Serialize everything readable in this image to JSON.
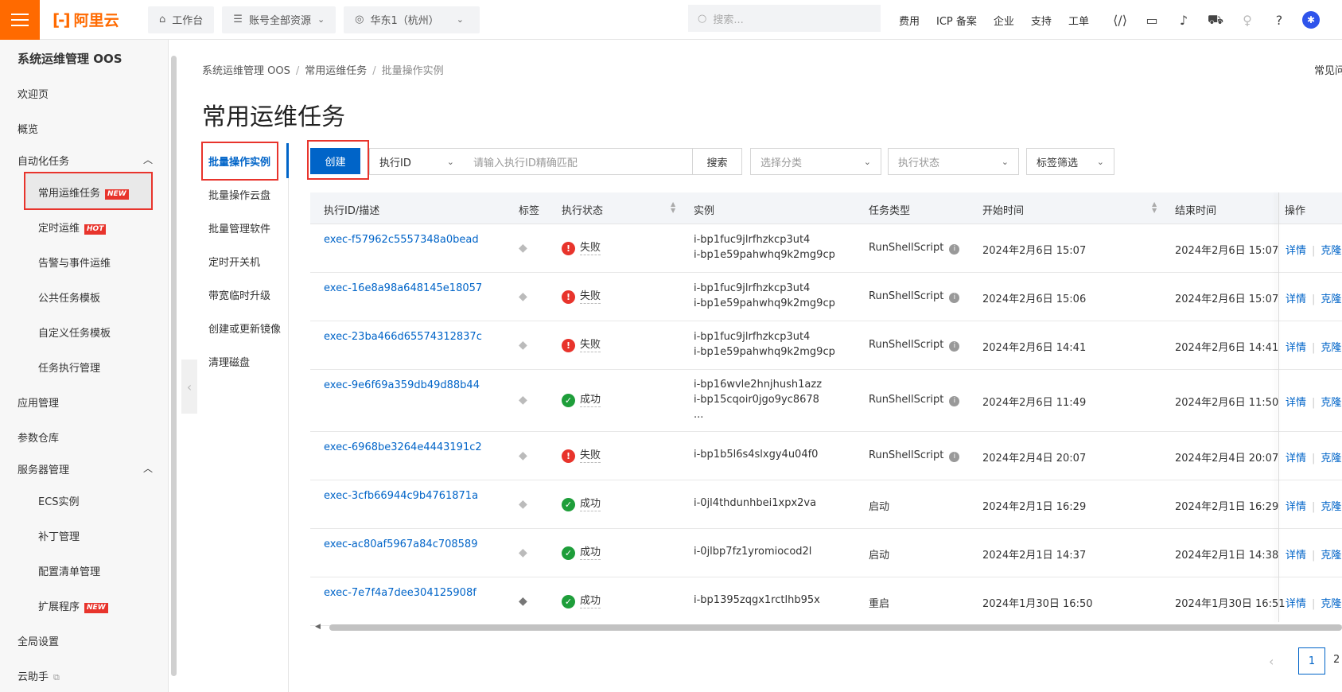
{
  "topbar": {
    "logo_text": "阿里云",
    "workbench": "工作台",
    "resources": "账号全部资源",
    "region": "华东1（杭州）",
    "search_placeholder": "搜索...",
    "links": [
      "费用",
      "ICP 备案",
      "企业",
      "支持",
      "工单"
    ],
    "icons": [
      "code-icon",
      "terminal-icon",
      "bell-icon",
      "cart-icon",
      "bulb-icon",
      "help-icon",
      "avatar-icon"
    ]
  },
  "sidebar": {
    "title": "系统运维管理 OOS",
    "welcome": "欢迎页",
    "overview": "概览",
    "automation_group": "自动化任务",
    "common_tasks": "常用运维任务",
    "scheduled": "定时运维",
    "alarm": "告警与事件运维",
    "public_templates": "公共任务模板",
    "custom_templates": "自定义任务模板",
    "execution_mgmt": "任务执行管理",
    "app_mgmt": "应用管理",
    "param_store": "参数仓库",
    "server_group": "服务器管理",
    "ecs": "ECS实例",
    "patch": "补丁管理",
    "inventory": "配置清单管理",
    "extensions": "扩展程序",
    "global_settings": "全局设置",
    "assistant": "云助手",
    "badge_new": "NEW",
    "badge_hot": "HOT"
  },
  "breadcrumb": [
    "系统运维管理 OOS",
    "常用运维任务",
    "批量操作实例"
  ],
  "faq": "常见问",
  "page_title": "常用运维任务",
  "subnav": [
    "批量操作实例",
    "批量操作云盘",
    "批量管理软件",
    "定时开关机",
    "带宽临时升级",
    "创建或更新镜像",
    "清理磁盘"
  ],
  "toolbar": {
    "create": "创建",
    "field_select": "执行ID",
    "search_placeholder": "请输入执行ID精确匹配",
    "search_btn": "搜索",
    "category_placeholder": "选择分类",
    "status_placeholder": "执行状态",
    "tag_filter": "标签筛选"
  },
  "table": {
    "headers": [
      "执行ID/描述",
      "标签",
      "执行状态",
      "实例",
      "任务类型",
      "开始时间",
      "结束时间",
      "操作"
    ],
    "detail_label": "详情",
    "clone_label": "克隆",
    "rows": [
      {
        "id": "exec-f57962c5557348a0bead",
        "status": "失败",
        "result": "fail",
        "instances": [
          "i-bp1fuc9jlrfhzkcp3ut4",
          "i-bp1e59pahwhq9k2mg9cp"
        ],
        "type": "RunShellScript",
        "start": "2024年2月6日 15:07",
        "end": "2024年2月6日 15:07"
      },
      {
        "id": "exec-16e8a98a648145e18057",
        "status": "失败",
        "result": "fail",
        "instances": [
          "i-bp1fuc9jlrfhzkcp3ut4",
          "i-bp1e59pahwhq9k2mg9cp"
        ],
        "type": "RunShellScript",
        "start": "2024年2月6日 15:06",
        "end": "2024年2月6日 15:07"
      },
      {
        "id": "exec-23ba466d65574312837c",
        "status": "失败",
        "result": "fail",
        "instances": [
          "i-bp1fuc9jlrfhzkcp3ut4",
          "i-bp1e59pahwhq9k2mg9cp"
        ],
        "type": "RunShellScript",
        "start": "2024年2月6日 14:41",
        "end": "2024年2月6日 14:41"
      },
      {
        "id": "exec-9e6f69a359db49d88b44",
        "status": "成功",
        "result": "ok",
        "instances": [
          "i-bp16wvle2hnjhush1azz",
          "i-bp15cqoir0jgo9yc8678",
          "..."
        ],
        "type": "RunShellScript",
        "start": "2024年2月6日 11:49",
        "end": "2024年2月6日 11:50"
      },
      {
        "id": "exec-6968be3264e4443191c2",
        "status": "失败",
        "result": "fail",
        "instances": [
          "i-bp1b5l6s4slxgy4u04f0"
        ],
        "type": "RunShellScript",
        "start": "2024年2月4日 20:07",
        "end": "2024年2月4日 20:07"
      },
      {
        "id": "exec-3cfb66944c9b4761871a",
        "status": "成功",
        "result": "ok",
        "instances": [
          "i-0jl4thdunhbei1xpx2va"
        ],
        "type": "启动",
        "start": "2024年2月1日 16:29",
        "end": "2024年2月1日 16:29"
      },
      {
        "id": "exec-ac80af5967a84c708589",
        "status": "成功",
        "result": "ok",
        "instances": [
          "i-0jlbp7fz1yromiocod2l"
        ],
        "type": "启动",
        "start": "2024年2月1日 14:37",
        "end": "2024年2月1日 14:38"
      },
      {
        "id": "exec-7e7f4a7dee304125908f",
        "status": "成功",
        "result": "ok",
        "instances": [
          "i-bp1395zqgx1rctlhb95x"
        ],
        "type": "重启",
        "start": "2024年1月30日 16:50",
        "end": "2024年1月30日 16:51"
      }
    ]
  },
  "pagination": {
    "current": "1",
    "next": "2"
  }
}
